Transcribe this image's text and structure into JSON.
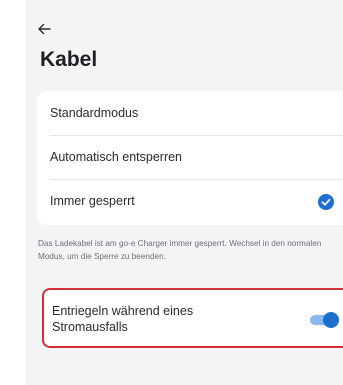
{
  "header": {
    "back_icon": "arrow-left-icon",
    "title": "Kabel"
  },
  "lock_modes": {
    "options": [
      {
        "label": "Standardmodus",
        "selected": false
      },
      {
        "label": "Automatisch entsperren",
        "selected": false
      },
      {
        "label": "Immer gesperrt",
        "selected": true
      }
    ],
    "selected_icon": "check-circle-icon",
    "info_text": "Das Ladekabel ist am go-e Charger immer gesperrt. Wechsel in den normalen Modus, um die Sperre zu beenden."
  },
  "power_outage": {
    "label": "Entriegeln während eines Stromausfalls",
    "enabled": true
  },
  "colors": {
    "background": "#f3f4f6",
    "accent": "#1f6fd0",
    "toggle_track": "#8bb8ec",
    "highlight_border": "#d32f3a"
  }
}
